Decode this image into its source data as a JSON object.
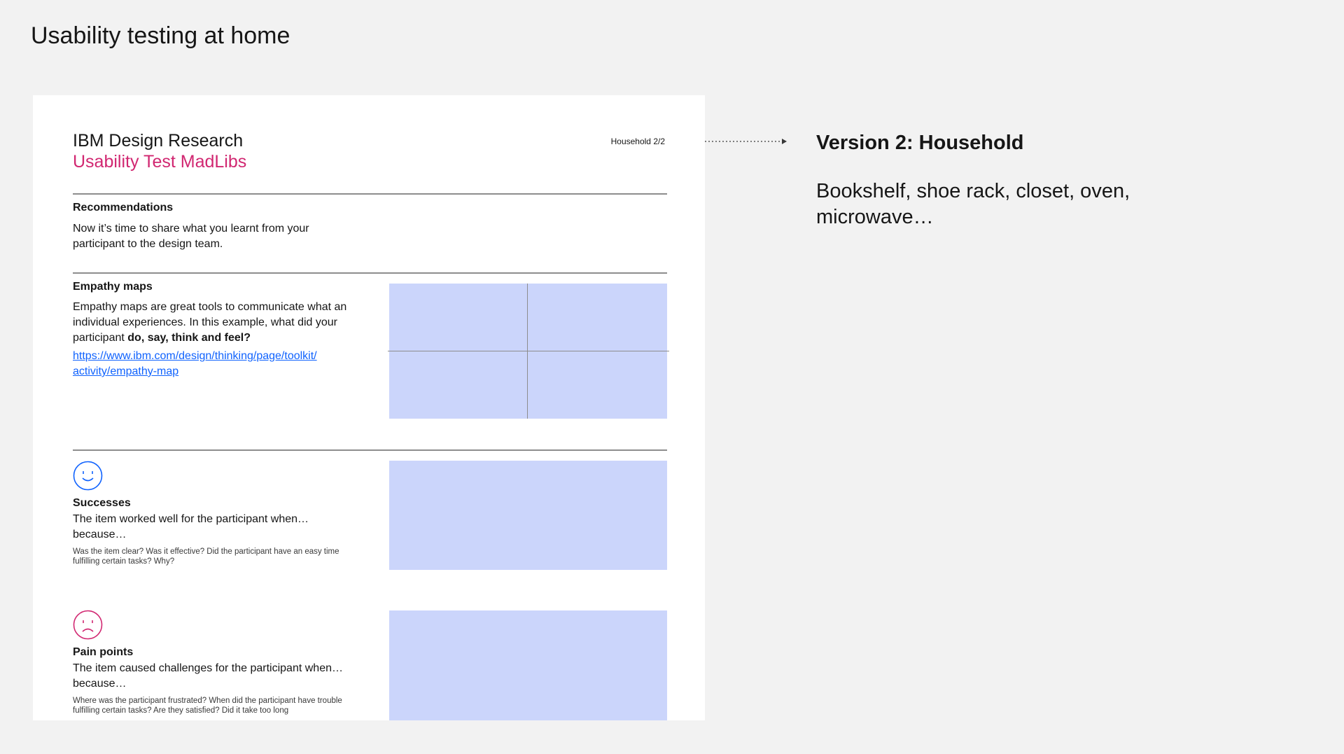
{
  "page": {
    "title": "Usability testing at home"
  },
  "doc": {
    "brand": "IBM Design Research",
    "subtitle": "Usability Test MadLibs",
    "tag": "Household 2/2",
    "recommendations": {
      "title": "Recommendations",
      "body": "Now it’s time to share what you learnt from your participant to the design team."
    },
    "empathy": {
      "title": "Empathy maps",
      "body_prefix": "Empathy maps are great tools to communicate what an individual experiences. In this example, what did your participant ",
      "body_bold": "do, say, think and feel?",
      "link_line1": "https://www.ibm.com/design/thinking/page/toolkit/",
      "link_line2": "activity/empathy-map"
    },
    "successes": {
      "title": "Successes",
      "body": "The item worked well for the participant when… because…",
      "hint": "Was the item clear? Was it effective? Did the participant have an easy time fulfilling certain tasks? Why?"
    },
    "pain_points": {
      "title": "Pain points",
      "body": "The item caused challenges for the participant when…because…",
      "hint": "Where was the participant frustrated? When did the participant have trouble fulfilling certain tasks? Are they satisfied? Did it take too long"
    }
  },
  "version": {
    "title": "Version 2: Household",
    "body": "Bookshelf, shoe rack, closet, oven, microwave…"
  },
  "icons": {
    "success": "smiley-face-icon",
    "pain": "sad-face-icon",
    "arrow": "dotted-arrow-icon"
  },
  "colors": {
    "background": "#f2f2f2",
    "accent_magenta": "#d12771",
    "link_blue": "#0f62fe",
    "box_fill": "#cbd5fb",
    "success_icon": "#0f62fe",
    "pain_icon": "#d12771"
  }
}
